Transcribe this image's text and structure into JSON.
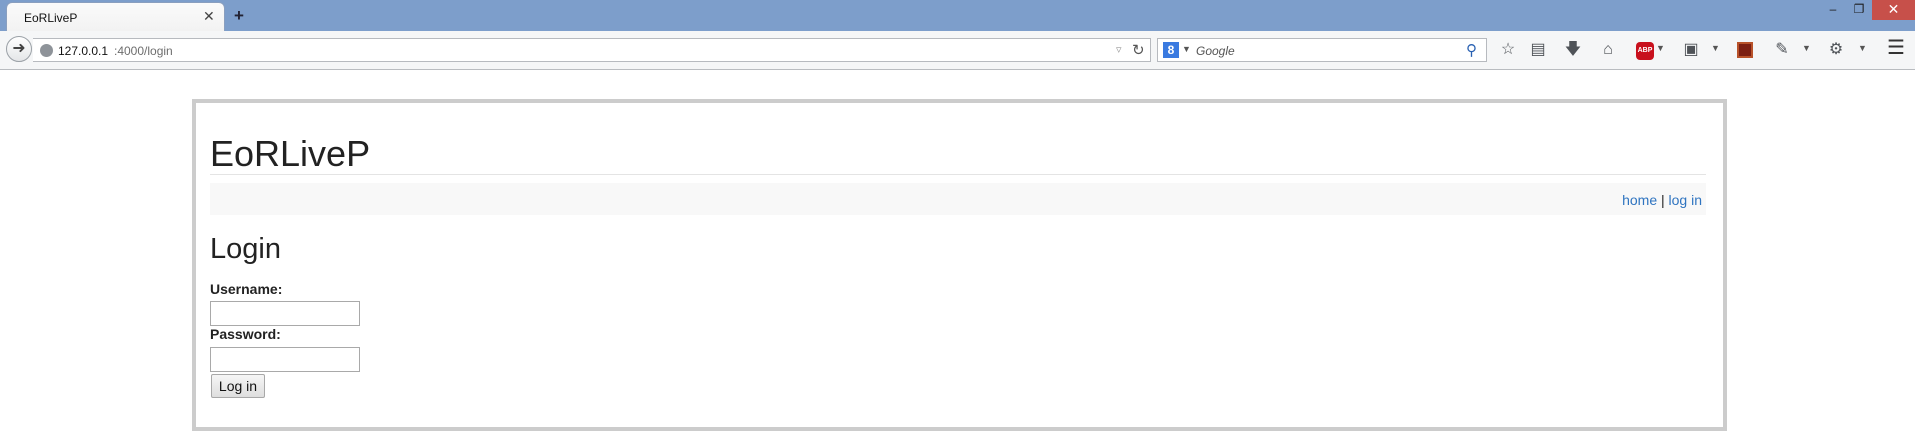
{
  "browser": {
    "tab_title": "EoRLiveP",
    "tab_close": "✕",
    "new_tab": "+",
    "window_controls": {
      "minimize": "‒",
      "maximize": "❐",
      "close": "✕"
    },
    "url_host": "127.0.0.1",
    "url_path": ":4000/login",
    "search_engine_letter": "8",
    "search_placeholder": "Google",
    "icons": [
      "back-arrow-icon",
      "globe-icon",
      "reload-icon",
      "search-icon",
      "bookmark-star-icon",
      "reading-list-icon",
      "download-icon",
      "home-icon",
      "adblock-plus-icon",
      "screenshot-icon",
      "extension-icon",
      "eyedropper-icon",
      "tools-icon",
      "hamburger-menu-icon"
    ],
    "abp_label": "ABP"
  },
  "page": {
    "site_title": "EoRLiveP",
    "menu": {
      "home": "home",
      "separator": " | ",
      "login": "log in"
    },
    "heading": "Login",
    "username_label": "Username:",
    "username_value": "",
    "password_label": "Password:",
    "password_value": "",
    "submit_label": "Log in"
  },
  "colors": {
    "titlebar": "#7d9ecb",
    "link": "#2f74c0",
    "container_border": "#cccccc"
  }
}
